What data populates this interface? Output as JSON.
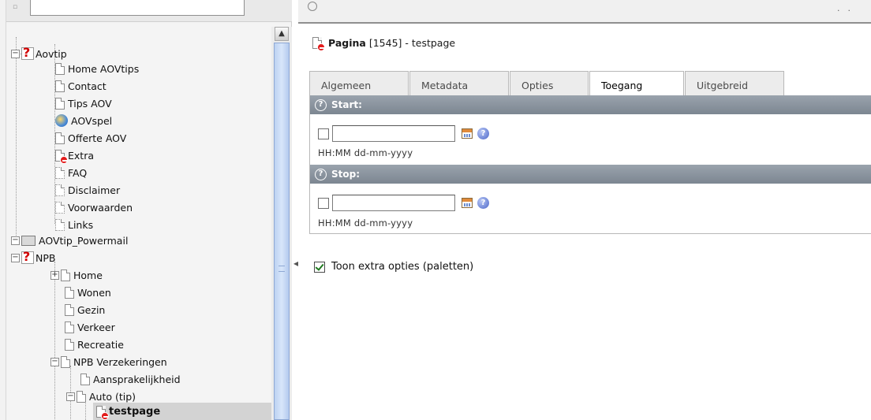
{
  "tree": {
    "filter_placeholder": "",
    "items": [
      {
        "label": "Aovtip"
      },
      {
        "label": "Home AOVtips"
      },
      {
        "label": "Contact"
      },
      {
        "label": "Tips AOV"
      },
      {
        "label": "AOVspel"
      },
      {
        "label": "Offerte AOV"
      },
      {
        "label": "Extra"
      },
      {
        "label": "FAQ"
      },
      {
        "label": "Disclaimer"
      },
      {
        "label": "Voorwaarden"
      },
      {
        "label": "Links"
      },
      {
        "label": "AOVtip_Powermail"
      },
      {
        "label": "NPB"
      },
      {
        "label": "Home"
      },
      {
        "label": "Wonen"
      },
      {
        "label": "Gezin"
      },
      {
        "label": "Verkeer"
      },
      {
        "label": "Recreatie"
      },
      {
        "label": "NPB Verzekeringen"
      },
      {
        "label": "Aansprakelijkheid"
      },
      {
        "label": "Auto (tip)"
      },
      {
        "label": "testpage"
      }
    ]
  },
  "header": {
    "record_type": "Pagina",
    "record_info": "[1545] - testpage"
  },
  "tabs": [
    {
      "label": "Algemeen"
    },
    {
      "label": "Metadata"
    },
    {
      "label": "Opties"
    },
    {
      "label": "Toegang"
    },
    {
      "label": "Uitgebreid"
    }
  ],
  "active_tab": "Toegang",
  "sections": {
    "start": {
      "title": "Start:",
      "value": "",
      "hint": "HH:MM dd-mm-yyyy"
    },
    "stop": {
      "title": "Stop:",
      "value": "",
      "hint": "HH:MM dd-mm-yyyy"
    }
  },
  "extra_options": {
    "label": "Toon extra opties (paletten)",
    "checked": true
  }
}
